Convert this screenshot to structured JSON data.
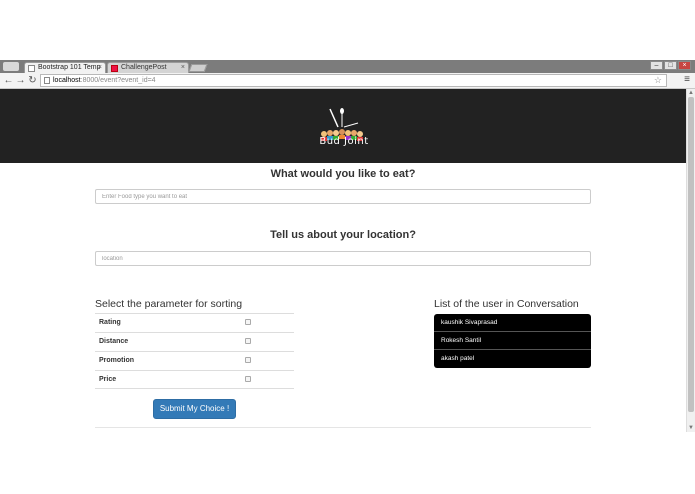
{
  "browser": {
    "tabs": [
      {
        "label": "Bootstrap 101 Temp",
        "active": true
      },
      {
        "label": "ChallengePost",
        "active": false
      }
    ],
    "address": {
      "host": "localhost",
      "rest": ":8000/event?event_id=4"
    },
    "window_controls": {
      "minimize": "–",
      "maximize": "□",
      "close": "×"
    },
    "nav": {
      "back": "←",
      "forward": "→",
      "reload": "↻"
    },
    "star": "☆",
    "menu": "≡",
    "tab_close": "×"
  },
  "brand": {
    "name": "Bud Joint"
  },
  "food": {
    "question": "What would you like to eat?",
    "placeholder": "Enter Food type you want to eat"
  },
  "location": {
    "question": "Tell us about your location?",
    "placeholder": "location"
  },
  "sorting": {
    "title": "Select the parameter for sorting",
    "options": [
      "Rating",
      "Distance",
      "Promotion",
      "Price"
    ]
  },
  "users": {
    "title": "List of the user in Conversation",
    "items": [
      "kaushik Sivaprasad",
      "Rokesh Santil",
      "akash patel"
    ]
  },
  "submit": {
    "label": "Submit My Choice !"
  },
  "colors": {
    "hero_bg": "#222222",
    "primary": "#337ab7",
    "list_bg": "#000000"
  }
}
